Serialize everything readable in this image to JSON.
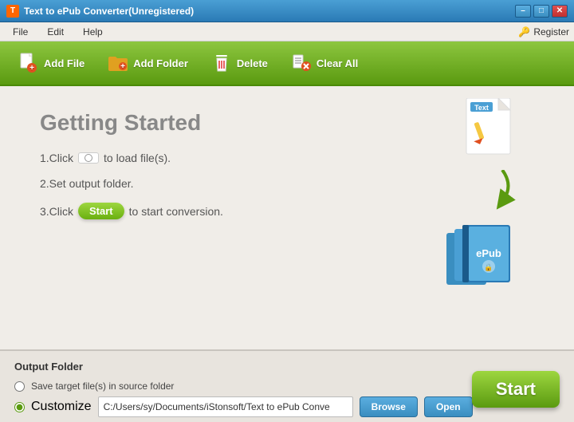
{
  "titlebar": {
    "title": "Text to ePub Converter(Unregistered)",
    "icon": "T",
    "min_label": "–",
    "max_label": "□",
    "close_label": "✕"
  },
  "menubar": {
    "items": [
      {
        "label": "File",
        "id": "menu-file"
      },
      {
        "label": "Edit",
        "id": "menu-edit"
      },
      {
        "label": "Help",
        "id": "menu-help"
      }
    ],
    "register_label": "Register",
    "register_icon": "🔑"
  },
  "toolbar": {
    "add_file_label": "Add File",
    "add_folder_label": "Add Folder",
    "delete_label": "Delete",
    "clear_all_label": "Clear All"
  },
  "main": {
    "title": "Getting Started",
    "step1_prefix": "1.Click",
    "step1_suffix": "to load file(s).",
    "step2": "2.Set output folder.",
    "step3_prefix": "3.Click",
    "step3_suffix": "to start conversion.",
    "start_btn_label": "Start"
  },
  "output": {
    "label": "Output Folder",
    "radio1_label": "Save target file(s) in source folder",
    "radio2_label": "Customize",
    "path_value": "C:/Users/sy/Documents/iStonsoft/Text to ePub Conve",
    "browse_label": "Browse",
    "open_label": "Open",
    "start_label": "Start"
  },
  "colors": {
    "toolbar_green": "#6aaa10",
    "button_blue": "#3a8ec0",
    "start_green": "#6aaa10"
  }
}
